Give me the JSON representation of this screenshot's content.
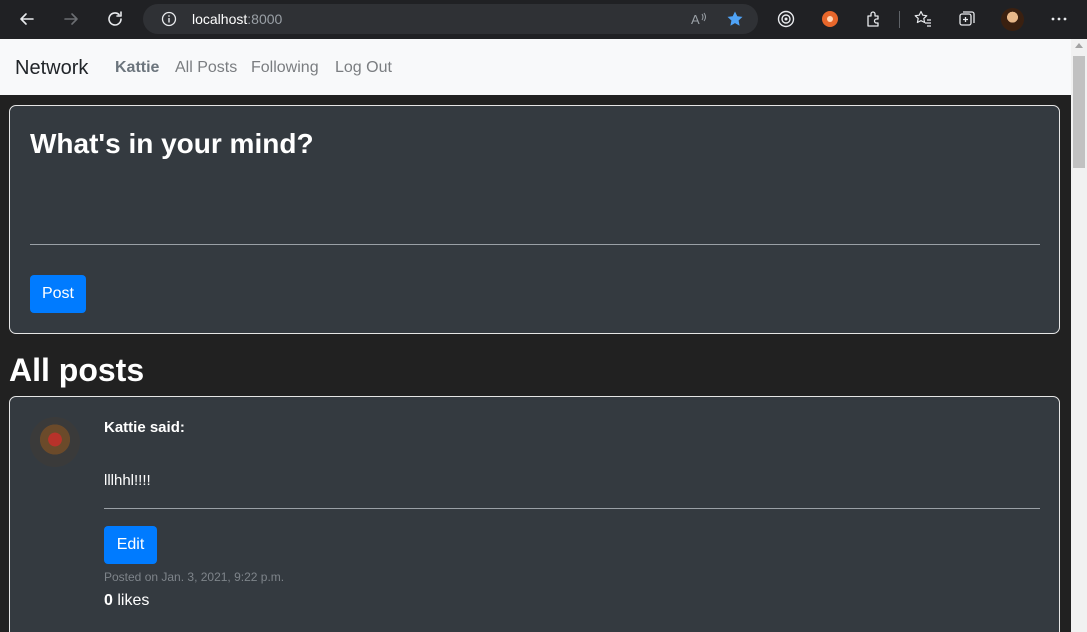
{
  "browser": {
    "url_host": "localhost",
    "url_port": ":8000"
  },
  "navbar": {
    "brand": "Network",
    "user": "Kattie",
    "links": [
      "All Posts",
      "Following",
      "Log Out"
    ]
  },
  "compose": {
    "title": "What's in your mind?",
    "post_button": "Post"
  },
  "section": {
    "title": "All posts"
  },
  "posts": [
    {
      "author": "Kattie said:",
      "content": "lllhhl!!!!",
      "edit_button": "Edit",
      "date": "Posted on Jan. 3, 2021, 9:22 p.m.",
      "likes_count": "0",
      "likes_label": " likes"
    }
  ],
  "colors": {
    "accent": "#007bff",
    "card_bg": "#343a40",
    "page_bg": "#212121",
    "navbar_bg": "#f8f9fa"
  }
}
